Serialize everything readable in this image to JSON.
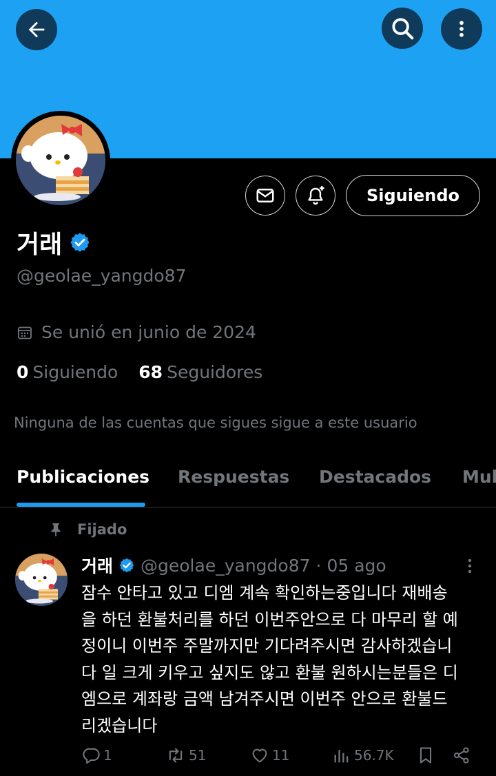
{
  "header": {
    "back_icon": "arrow-left-icon",
    "search_icon": "search-icon",
    "more_icon": "more-vertical-icon",
    "banner_color": "#1da1f2"
  },
  "profile": {
    "name": "거래",
    "verified": true,
    "handle": "@geolae_yangdo87",
    "joined": "Se unió en junio de 2024",
    "following_count": "0",
    "following_label": "Siguiendo",
    "followers_count": "68",
    "followers_label": "Seguidores",
    "mutuals_note": "Ninguna de las cuentas que sigues sigue a este usuario",
    "follow_button": "Siguiendo",
    "message_icon": "mail-icon",
    "notify_icon": "bell-plus-icon"
  },
  "tabs": [
    {
      "label": "Publicaciones",
      "active": true
    },
    {
      "label": "Respuestas",
      "active": false
    },
    {
      "label": "Destacados",
      "active": false
    },
    {
      "label": "Mul",
      "active": false
    }
  ],
  "post": {
    "pinned_label": "Fijado",
    "author_name": "거래",
    "author_handle": "@geolae_yangdo87",
    "separator": "·",
    "date": "05 ago",
    "text_lines": [
      "잠수 안타고 있고 디엠 계속 확인하는중입니다 재배송",
      "을 하던 환불처리를 하던 이번주안으로 다 마무리 할 예",
      "정이니 이번주 주말까지만 기다려주시면 감사하겠습니",
      "다 일 크게 키우고 싶지도 않고 환불 원하시는분들은 디",
      "엠으로 계좌랑 금액 남겨주시면 이번주 안으로 환불드",
      "리겠습니다"
    ],
    "replies": "1",
    "reposts": "51",
    "likes": "11",
    "views": "56.7K"
  },
  "colors": {
    "accent": "#1d9bf0",
    "muted": "#71767b",
    "verified": "#1d9bf0"
  }
}
